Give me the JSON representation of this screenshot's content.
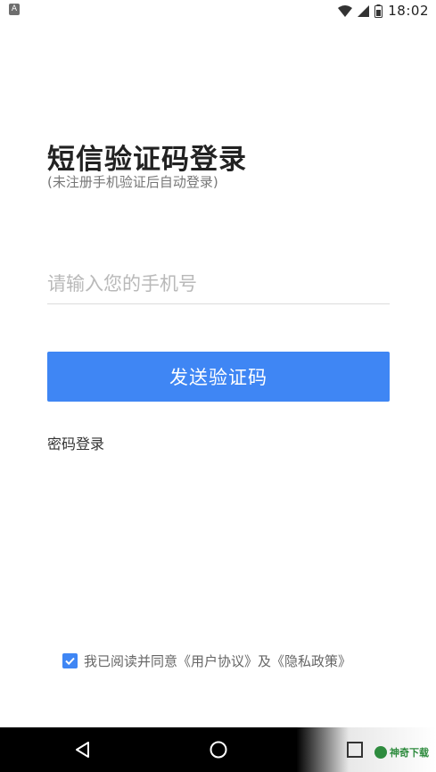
{
  "status_bar": {
    "time": "18:02",
    "left_icon": "A"
  },
  "login": {
    "title": "短信验证码登录",
    "subtitle": "(未注册手机验证后自动登录)",
    "phone_placeholder": "请输入您的手机号",
    "send_button": "发送验证码",
    "password_login": "密码登录"
  },
  "agreement": {
    "prefix": "我已阅读并同意",
    "user_agreement": "《用户协议》",
    "and": "及",
    "privacy_policy": "《隐私政策》",
    "checked": true
  },
  "watermark": {
    "text": "神奇下载"
  },
  "colors": {
    "accent": "#3f86f4",
    "title": "#222222",
    "subtitle": "#777777"
  },
  "icons": [
    "wifi-icon",
    "signal-icon",
    "battery-icon",
    "checkmark-icon",
    "back-icon",
    "home-icon",
    "recents-icon"
  ]
}
